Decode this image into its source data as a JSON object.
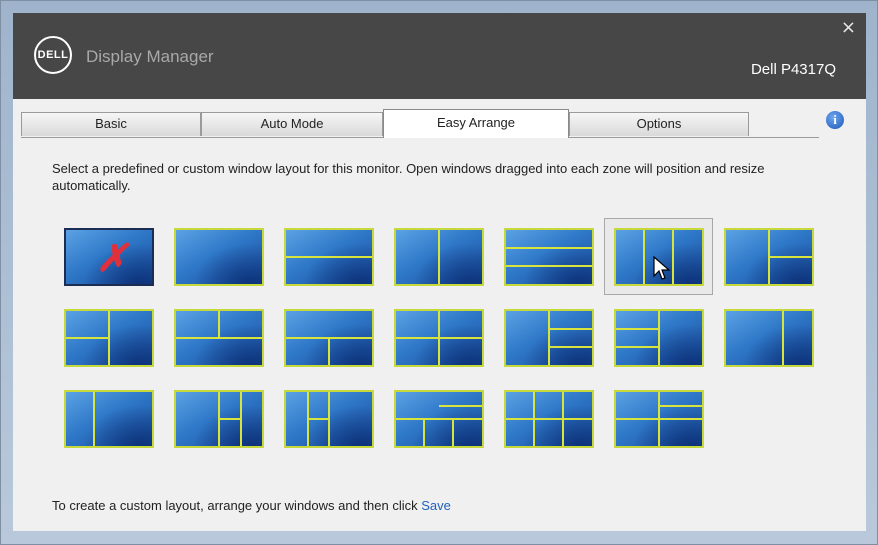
{
  "header": {
    "logo_text": "DELL",
    "app_title": "Display Manager",
    "model": "Dell P4317Q",
    "close_label": "×"
  },
  "tabs": [
    {
      "label": "Basic",
      "active": false
    },
    {
      "label": "Auto Mode",
      "active": false
    },
    {
      "label": "Easy Arrange",
      "active": true
    },
    {
      "label": "Options",
      "active": false
    }
  ],
  "info_label": "i",
  "description": "Select a predefined or custom window layout for this monitor. Open windows dragged into each zone will position and resize automatically.",
  "footer": {
    "text": "To create a custom layout, arrange your windows and then click ",
    "link": "Save"
  },
  "layouts": {
    "selected_index": 5,
    "tiles": [
      {
        "name": "layout-none"
      },
      {
        "name": "layout-full"
      },
      {
        "name": "layout-two-rows"
      },
      {
        "name": "layout-two-columns"
      },
      {
        "name": "layout-three-rows"
      },
      {
        "name": "layout-three-columns"
      },
      {
        "name": "layout-four-grid"
      },
      {
        "name": "layout-left-split-right"
      },
      {
        "name": "layout-top-split-bottom"
      },
      {
        "name": "layout-top-bottom-split"
      },
      {
        "name": "layout-left-right-split"
      },
      {
        "name": "layout-right-three-stack"
      },
      {
        "name": "layout-left-three-stack"
      },
      {
        "name": "layout-wide-left-narrow-right"
      },
      {
        "name": "layout-narrow-left-wide-right"
      },
      {
        "name": "layout-right-columns-split"
      },
      {
        "name": "layout-left-column-split"
      },
      {
        "name": "layout-top-wide-bottom-three"
      },
      {
        "name": "layout-six-grid"
      },
      {
        "name": "layout-center-cross"
      }
    ]
  }
}
